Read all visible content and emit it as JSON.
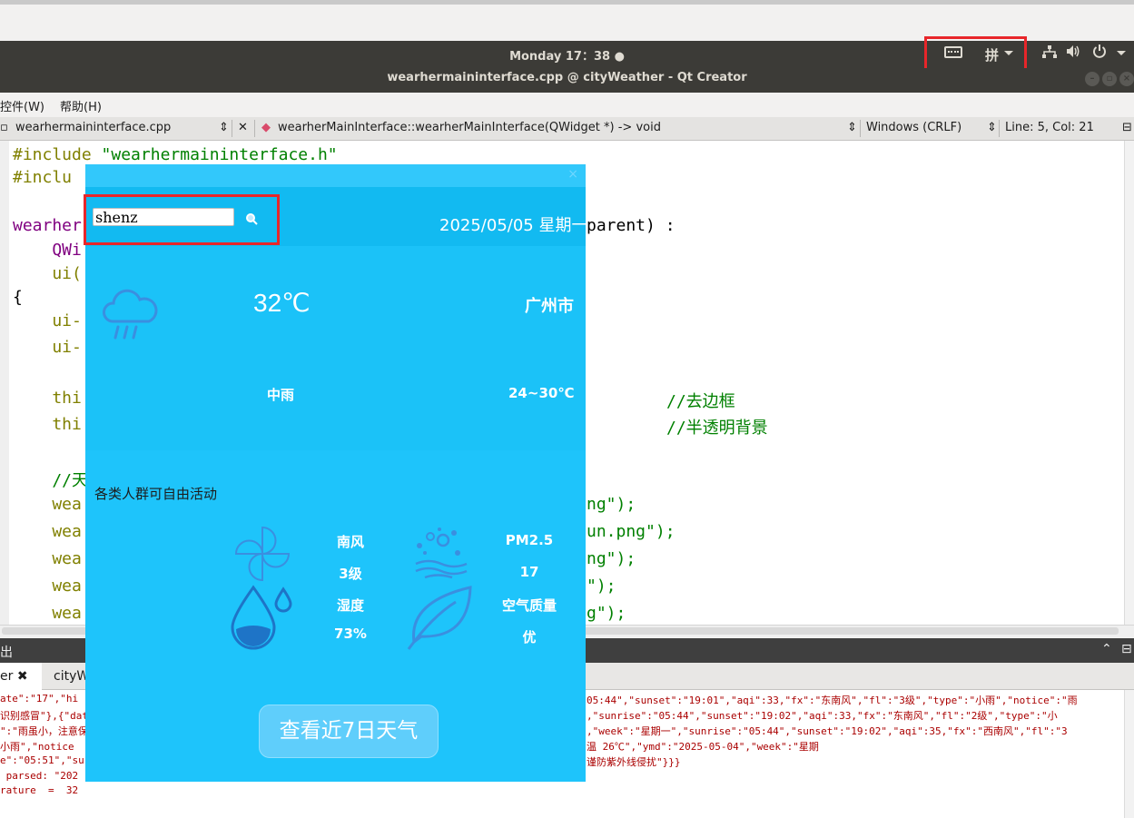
{
  "system": {
    "clock": "Monday 17：38 ●",
    "input_method": "拼"
  },
  "window": {
    "title": "wearhermaininterface.cpp @ cityWeather - Qt Creator"
  },
  "menubar": {
    "items": [
      "控件(W)",
      "帮助(H)"
    ]
  },
  "editor": {
    "file_tab": "wearhermaininterface.cpp",
    "symbol": "wearherMainInterface::wearherMainInterface(QWidget *) -> void",
    "line_ending": "Windows (CRLF)",
    "cursor": "Line: 5, Col: 21"
  },
  "code": {
    "l1_directive": "#include ",
    "l1_string": "\"wearhermaininterface.h\"",
    "l2": "#inclu",
    "l4_prefix": "wearher",
    "l4_suffix": "parent) :",
    "l5": "    QWi",
    "l6": "    ui(",
    "l7": "{",
    "l8": "    ui-",
    "l9": "    ui-",
    "l11_code": "    thi",
    "l11_comment": "//去边框",
    "l12_code": "    thi",
    "l12_comment": "//半透明背景",
    "l14": "    //天",
    "l15_code": "    wea",
    "l15_suffix": "ng\");",
    "l16_code": "    wea",
    "l16_suffix": "un.png\");",
    "l17_code": "    wea",
    "l17_suffix": "ng\");",
    "l18_code": "    wea",
    "l18_suffix": "\");",
    "l19_code": "    wea",
    "l19_suffix": "g\");"
  },
  "output": {
    "header": "出",
    "tabs": [
      "er ✖",
      "cityW"
    ],
    "lines_left": [
      "ate\":\"17\",\"hi",
      "识别感冒\"},{\"dat",
      "\":\"雨虽小，注意保",
      "小雨\",\"notice",
      "e\":\"05:51\",\"su",
      " parsed: \"202",
      "rature  =  32"
    ],
    "lines_right": [
      "05:44\",\"sunset\":\"19:01\",\"aqi\":33,\"fx\":\"东南风\",\"fl\":\"3级\",\"type\":\"小雨\",\"notice\":\"雨",
      ",\"sunrise\":\"05:44\",\"sunset\":\"19:02\",\"aqi\":33,\"fx\":\"东南风\",\"fl\":\"2级\",\"type\":\"小",
      ",\"week\":\"星期一\",\"sunrise\":\"05:44\",\"sunset\":\"19:02\",\"aqi\":35,\"fx\":\"西南风\",\"fl\":\"3",
      "温 26℃\",\"ymd\":\"2025-05-04\",\"week\":\"星期",
      "谨防紫外线侵扰\"}}}"
    ]
  },
  "weather": {
    "search_value": "shenz",
    "date": "2025/05/05 星期一",
    "temperature": "32℃",
    "city": "广州市",
    "condition": "中雨",
    "temp_range": "24~30℃",
    "tip": "各类人群可自由活动",
    "wind_dir": "南风",
    "wind_level": "3级",
    "humidity_label": "湿度",
    "humidity_value": "73%",
    "pm25_label": "PM2.5",
    "pm25_value": "17",
    "aq_label": "空气质量",
    "aq_value": "优",
    "forecast_button": "查看近7日天气",
    "colors": {
      "panel": "#1fc1f5",
      "icon": "#3a8fe0",
      "highlight": "#e8262a"
    },
    "icons": [
      "rain-cloud-icon",
      "pinwheel-icon",
      "water-drop-icon",
      "pm25-dots-icon",
      "leaf-icon",
      "search-icon"
    ]
  }
}
